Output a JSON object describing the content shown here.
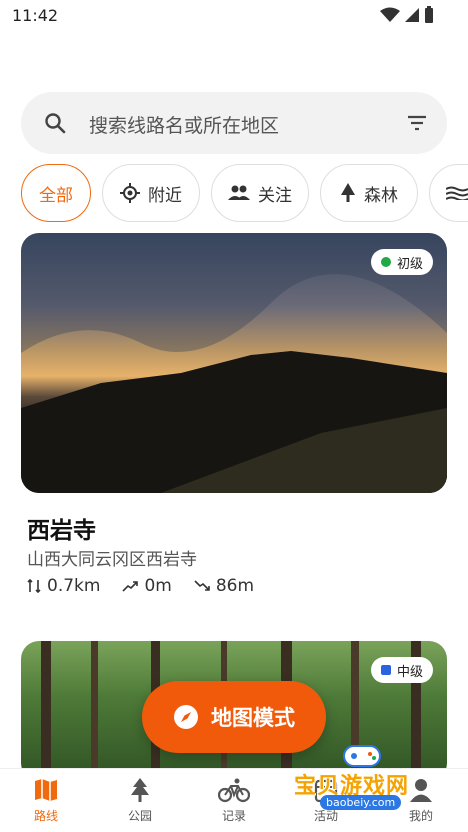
{
  "status": {
    "time": "11:42"
  },
  "search": {
    "placeholder": "搜索线路名或所在地区"
  },
  "chips": [
    {
      "label": "全部"
    },
    {
      "label": "附近"
    },
    {
      "label": "关注"
    },
    {
      "label": "森林"
    }
  ],
  "routes": [
    {
      "title": "西岩寺",
      "location": "山西大同云冈区西岩寺",
      "distance": "0.7km",
      "ascent": "0m",
      "descent": "86m",
      "level": "初级",
      "level_color": "#22a845"
    },
    {
      "level": "中级",
      "level_color": "#2a62e0"
    }
  ],
  "map_button": {
    "label": "地图模式"
  },
  "tabs": [
    {
      "label": "路线"
    },
    {
      "label": "公园"
    },
    {
      "label": "记录"
    },
    {
      "label": "活动"
    },
    {
      "label": "我的"
    }
  ],
  "watermark": {
    "text": "宝贝游戏网",
    "url": "baobeiy.com"
  },
  "colors": {
    "accent": "#f06a0f",
    "button": "#f05a0a"
  }
}
